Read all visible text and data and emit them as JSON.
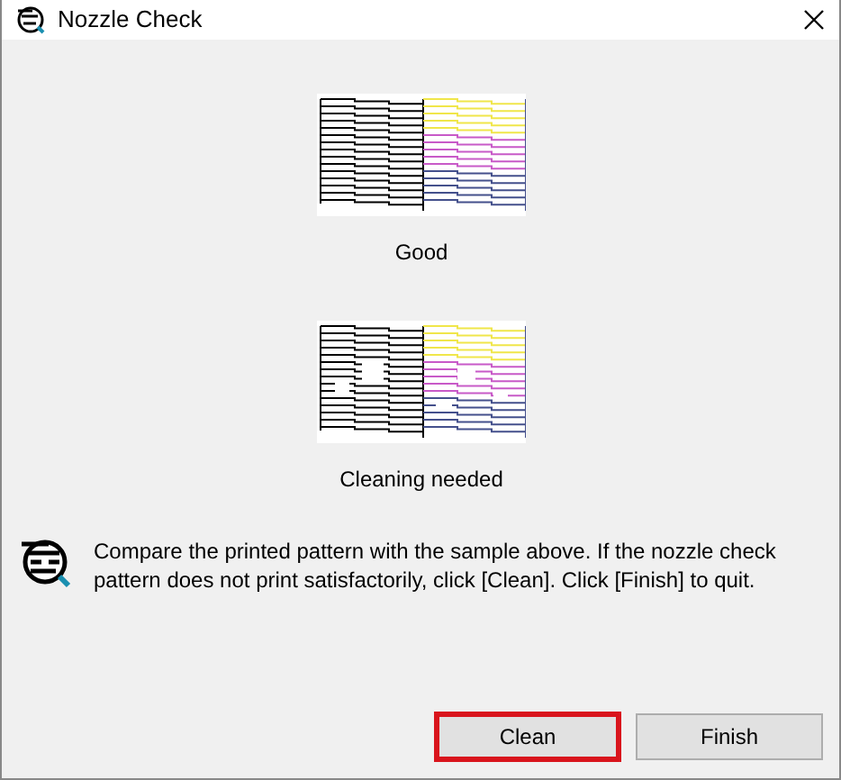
{
  "window": {
    "title": "Nozzle Check"
  },
  "samples": [
    {
      "kind": "good",
      "label": "Good"
    },
    {
      "kind": "clogged",
      "label": "Cleaning needed"
    }
  ],
  "message": "Compare the printed pattern with the sample above. If the nozzle check pattern does not print satisfactorily, click [Clean]. Click [Finish] to quit.",
  "buttons": [
    {
      "label": "Clean",
      "highlighted": true
    },
    {
      "label": "Finish",
      "highlighted": false
    }
  ]
}
